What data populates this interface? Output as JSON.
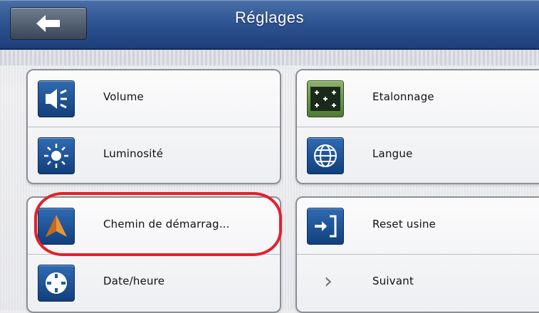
{
  "header": {
    "title": "Réglages"
  },
  "menu": {
    "volume": "Volume",
    "etalonnage": "Etalonnage",
    "luminosite": "Luminosité",
    "langue": "Langue",
    "chemin": "Chemin de démarrag...",
    "reset": "Reset usine",
    "date": "Date/heure",
    "suivant": "Suivant"
  },
  "colors": {
    "header_blue": "#2f5593",
    "icon_blue": "#1f5aa0",
    "highlight_red": "#e4202a"
  },
  "icons": [
    "back-arrow-icon",
    "speaker-icon",
    "calibration-grid-icon",
    "sun-icon",
    "globe-icon",
    "navigation-arrow-icon",
    "exit-door-icon",
    "clock-icon",
    "chevron-right-icon"
  ]
}
